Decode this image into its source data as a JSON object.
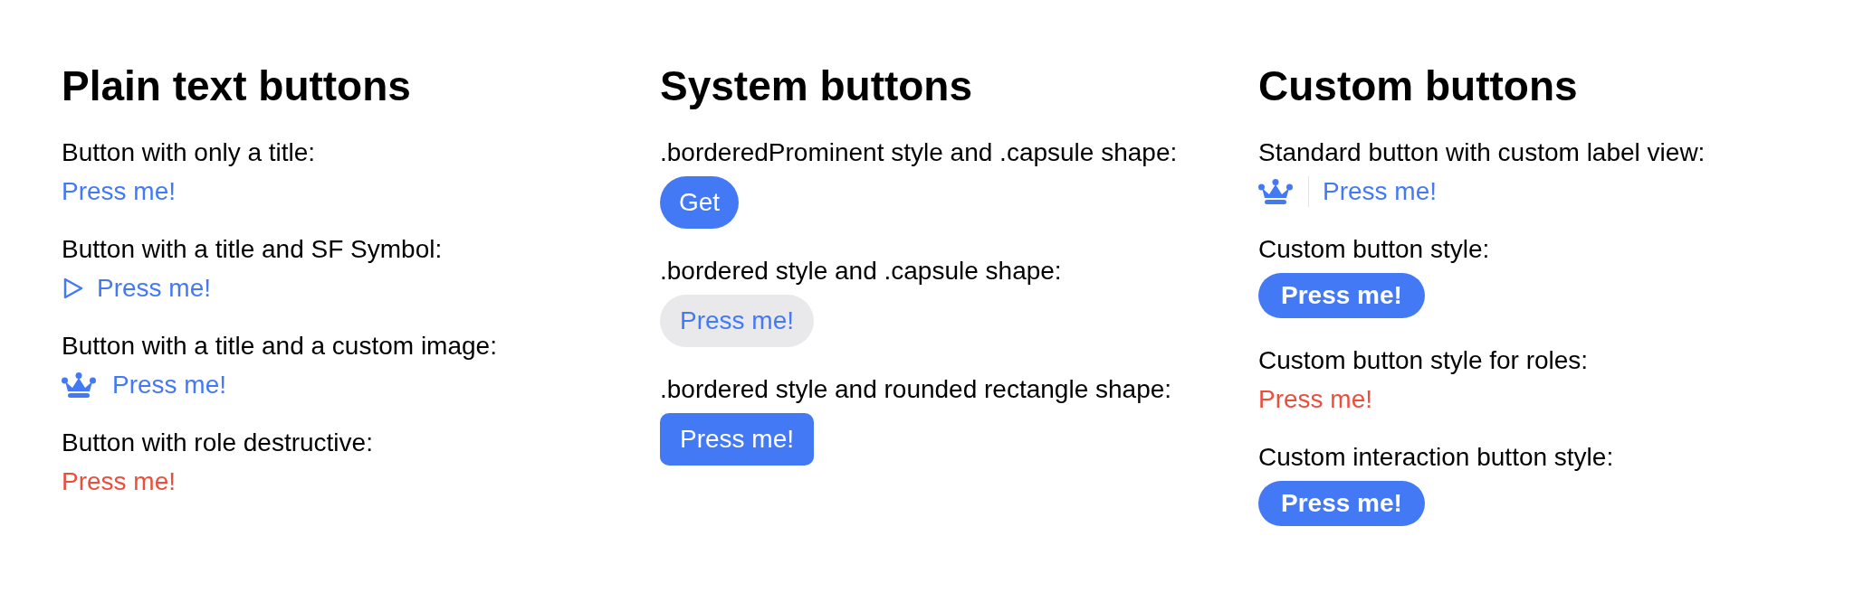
{
  "columns": [
    {
      "title": "Plain text buttons",
      "items": [
        {
          "label": "Button with only a title:",
          "button": {
            "kind": "text",
            "text": "Press me!",
            "destructive": false
          }
        },
        {
          "label": "Button with a title and SF Symbol:",
          "button": {
            "kind": "symbol",
            "text": "Press me!",
            "destructive": false
          }
        },
        {
          "label": "Button with a title and a custom image:",
          "button": {
            "kind": "image",
            "text": "Press me!",
            "destructive": false
          }
        },
        {
          "label": "Button with role destructive:",
          "button": {
            "kind": "text",
            "text": "Press me!",
            "destructive": true
          }
        }
      ]
    },
    {
      "title": "System buttons",
      "items": [
        {
          "label": ".borderedProminent style and .capsule shape:",
          "button": {
            "kind": "prominent_capsule",
            "text": "Get",
            "destructive": false
          }
        },
        {
          "label": ".bordered style and .capsule shape:",
          "button": {
            "kind": "bordered_capsule",
            "text": "Press me!",
            "destructive": false
          }
        },
        {
          "label": ".bordered style and rounded rectangle shape:",
          "button": {
            "kind": "bordered_rounded",
            "text": "Press me!",
            "destructive": false
          }
        }
      ]
    },
    {
      "title": "Custom buttons",
      "items": [
        {
          "label": "Standard button with custom label view:",
          "button": {
            "kind": "label_view",
            "text": "Press me!",
            "destructive": false
          }
        },
        {
          "label": "Custom button style:",
          "button": {
            "kind": "custom_capsule",
            "text": "Press me!",
            "destructive": false
          }
        },
        {
          "label": "Custom button style for roles:",
          "button": {
            "kind": "text",
            "text": "Press me!",
            "destructive": true
          }
        },
        {
          "label": "Custom interaction button style:",
          "button": {
            "kind": "custom_capsule",
            "text": "Press me!",
            "destructive": false
          }
        }
      ]
    }
  ]
}
